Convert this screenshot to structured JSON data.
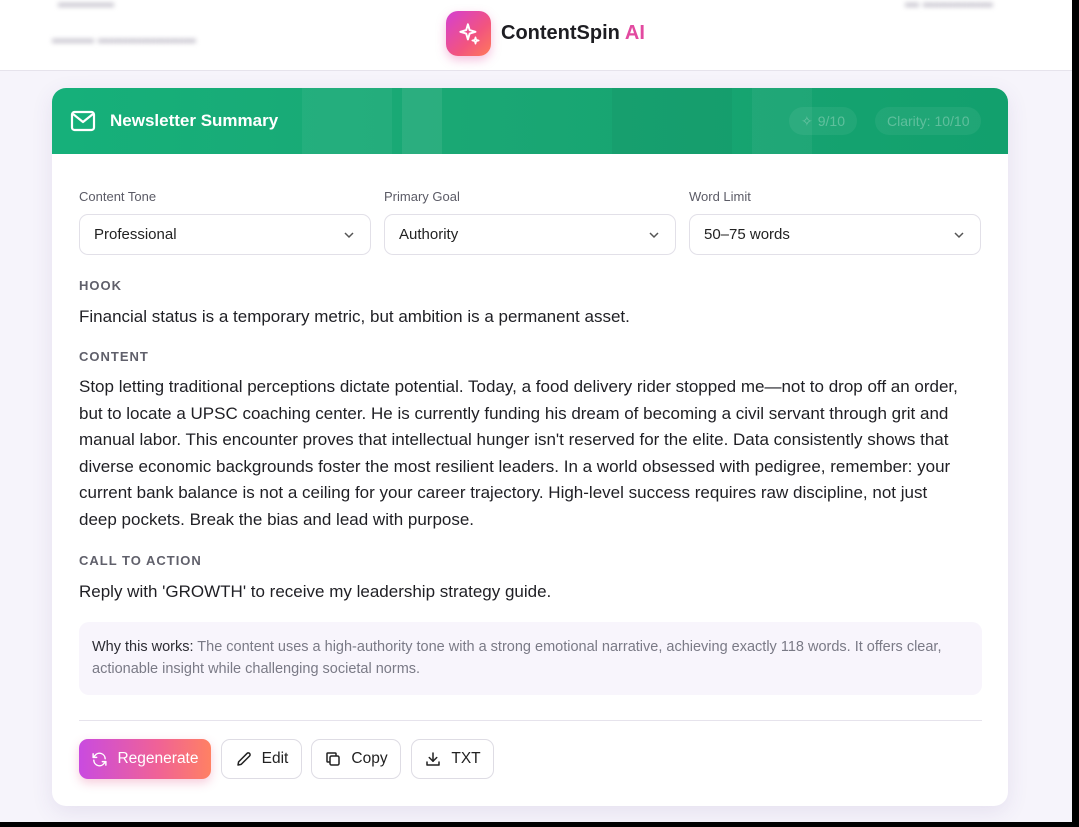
{
  "app": {
    "brand_name": "ContentSpin",
    "brand_ai": "AI"
  },
  "card": {
    "title": "Newsletter Summary",
    "badges": [
      "9/10",
      "Clarity: 10/10"
    ]
  },
  "controls": {
    "tone": {
      "label": "Content Tone",
      "value": "Professional"
    },
    "goal": {
      "label": "Primary Goal",
      "value": "Authority"
    },
    "limit": {
      "label": "Word Limit",
      "value": "50–75 words"
    }
  },
  "sections": {
    "hook_label": "HOOK",
    "hook_text": "Financial status is a temporary metric, but ambition is a permanent asset.",
    "content_label": "CONTENT",
    "content_lines": [
      "Stop letting traditional perceptions dictate potential. Today, a food delivery rider stopped me—not to drop off an order,",
      "but to locate a UPSC coaching center. He is currently funding his dream of becoming a civil servant through grit and",
      "manual labor. This encounter proves that intellectual hunger isn't reserved for the elite. Data consistently shows that",
      "diverse economic backgrounds foster the most resilient leaders. In a world obsessed with pedigree, remember: your",
      "current bank balance is not a ceiling for your career trajectory. High-level success requires raw discipline, not just",
      "deep pockets. Break the bias and lead with purpose."
    ],
    "cta_label": "CALL TO ACTION",
    "cta_text": "Reply with 'GROWTH' to receive my leadership strategy guide."
  },
  "why": {
    "label": "Why this works:",
    "text": " The content uses a high-authority tone with a strong emotional narrative, achieving exactly 118 words. It offers clear, actionable insight while challenging societal norms."
  },
  "actions": {
    "regenerate": "Regenerate",
    "edit": "Edit",
    "copy": "Copy",
    "txt": "TXT"
  },
  "icons": {
    "brand": "sparkle-icon",
    "header": "mail-icon",
    "select": "chevron-down-icon",
    "regenerate": "refresh-icon",
    "edit": "pencil-icon",
    "copy": "copy-icon",
    "txt": "download-icon"
  },
  "colors": {
    "header_green": "#16b07a",
    "brand_pink": "#e24aa0",
    "primary_gradient_start": "#c94be0",
    "primary_gradient_end": "#ff8163"
  }
}
